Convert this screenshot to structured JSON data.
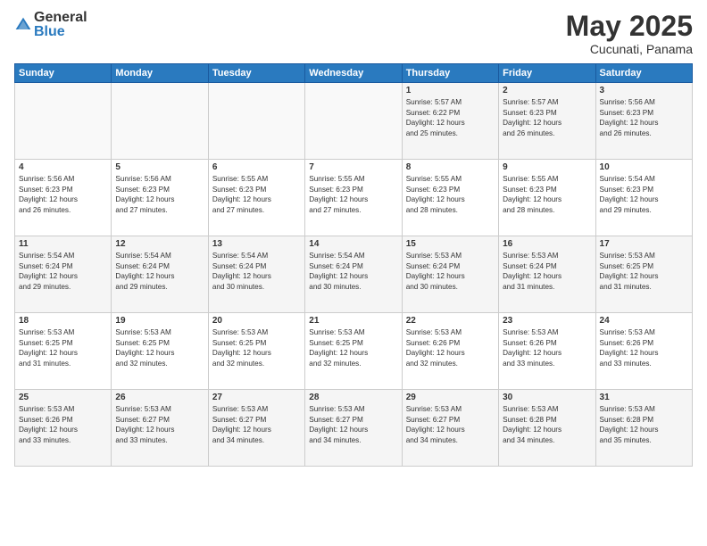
{
  "header": {
    "logo_general": "General",
    "logo_blue": "Blue",
    "month_title": "May 2025",
    "location": "Cucunati, Panama"
  },
  "days_of_week": [
    "Sunday",
    "Monday",
    "Tuesday",
    "Wednesday",
    "Thursday",
    "Friday",
    "Saturday"
  ],
  "weeks": [
    [
      {
        "day": "",
        "info": ""
      },
      {
        "day": "",
        "info": ""
      },
      {
        "day": "",
        "info": ""
      },
      {
        "day": "",
        "info": ""
      },
      {
        "day": "1",
        "info": "Sunrise: 5:57 AM\nSunset: 6:22 PM\nDaylight: 12 hours\nand 25 minutes."
      },
      {
        "day": "2",
        "info": "Sunrise: 5:57 AM\nSunset: 6:23 PM\nDaylight: 12 hours\nand 26 minutes."
      },
      {
        "day": "3",
        "info": "Sunrise: 5:56 AM\nSunset: 6:23 PM\nDaylight: 12 hours\nand 26 minutes."
      }
    ],
    [
      {
        "day": "4",
        "info": "Sunrise: 5:56 AM\nSunset: 6:23 PM\nDaylight: 12 hours\nand 26 minutes."
      },
      {
        "day": "5",
        "info": "Sunrise: 5:56 AM\nSunset: 6:23 PM\nDaylight: 12 hours\nand 27 minutes."
      },
      {
        "day": "6",
        "info": "Sunrise: 5:55 AM\nSunset: 6:23 PM\nDaylight: 12 hours\nand 27 minutes."
      },
      {
        "day": "7",
        "info": "Sunrise: 5:55 AM\nSunset: 6:23 PM\nDaylight: 12 hours\nand 27 minutes."
      },
      {
        "day": "8",
        "info": "Sunrise: 5:55 AM\nSunset: 6:23 PM\nDaylight: 12 hours\nand 28 minutes."
      },
      {
        "day": "9",
        "info": "Sunrise: 5:55 AM\nSunset: 6:23 PM\nDaylight: 12 hours\nand 28 minutes."
      },
      {
        "day": "10",
        "info": "Sunrise: 5:54 AM\nSunset: 6:23 PM\nDaylight: 12 hours\nand 29 minutes."
      }
    ],
    [
      {
        "day": "11",
        "info": "Sunrise: 5:54 AM\nSunset: 6:24 PM\nDaylight: 12 hours\nand 29 minutes."
      },
      {
        "day": "12",
        "info": "Sunrise: 5:54 AM\nSunset: 6:24 PM\nDaylight: 12 hours\nand 29 minutes."
      },
      {
        "day": "13",
        "info": "Sunrise: 5:54 AM\nSunset: 6:24 PM\nDaylight: 12 hours\nand 30 minutes."
      },
      {
        "day": "14",
        "info": "Sunrise: 5:54 AM\nSunset: 6:24 PM\nDaylight: 12 hours\nand 30 minutes."
      },
      {
        "day": "15",
        "info": "Sunrise: 5:53 AM\nSunset: 6:24 PM\nDaylight: 12 hours\nand 30 minutes."
      },
      {
        "day": "16",
        "info": "Sunrise: 5:53 AM\nSunset: 6:24 PM\nDaylight: 12 hours\nand 31 minutes."
      },
      {
        "day": "17",
        "info": "Sunrise: 5:53 AM\nSunset: 6:25 PM\nDaylight: 12 hours\nand 31 minutes."
      }
    ],
    [
      {
        "day": "18",
        "info": "Sunrise: 5:53 AM\nSunset: 6:25 PM\nDaylight: 12 hours\nand 31 minutes."
      },
      {
        "day": "19",
        "info": "Sunrise: 5:53 AM\nSunset: 6:25 PM\nDaylight: 12 hours\nand 32 minutes."
      },
      {
        "day": "20",
        "info": "Sunrise: 5:53 AM\nSunset: 6:25 PM\nDaylight: 12 hours\nand 32 minutes."
      },
      {
        "day": "21",
        "info": "Sunrise: 5:53 AM\nSunset: 6:25 PM\nDaylight: 12 hours\nand 32 minutes."
      },
      {
        "day": "22",
        "info": "Sunrise: 5:53 AM\nSunset: 6:26 PM\nDaylight: 12 hours\nand 32 minutes."
      },
      {
        "day": "23",
        "info": "Sunrise: 5:53 AM\nSunset: 6:26 PM\nDaylight: 12 hours\nand 33 minutes."
      },
      {
        "day": "24",
        "info": "Sunrise: 5:53 AM\nSunset: 6:26 PM\nDaylight: 12 hours\nand 33 minutes."
      }
    ],
    [
      {
        "day": "25",
        "info": "Sunrise: 5:53 AM\nSunset: 6:26 PM\nDaylight: 12 hours\nand 33 minutes."
      },
      {
        "day": "26",
        "info": "Sunrise: 5:53 AM\nSunset: 6:27 PM\nDaylight: 12 hours\nand 33 minutes."
      },
      {
        "day": "27",
        "info": "Sunrise: 5:53 AM\nSunset: 6:27 PM\nDaylight: 12 hours\nand 34 minutes."
      },
      {
        "day": "28",
        "info": "Sunrise: 5:53 AM\nSunset: 6:27 PM\nDaylight: 12 hours\nand 34 minutes."
      },
      {
        "day": "29",
        "info": "Sunrise: 5:53 AM\nSunset: 6:27 PM\nDaylight: 12 hours\nand 34 minutes."
      },
      {
        "day": "30",
        "info": "Sunrise: 5:53 AM\nSunset: 6:28 PM\nDaylight: 12 hours\nand 34 minutes."
      },
      {
        "day": "31",
        "info": "Sunrise: 5:53 AM\nSunset: 6:28 PM\nDaylight: 12 hours\nand 35 minutes."
      }
    ]
  ]
}
